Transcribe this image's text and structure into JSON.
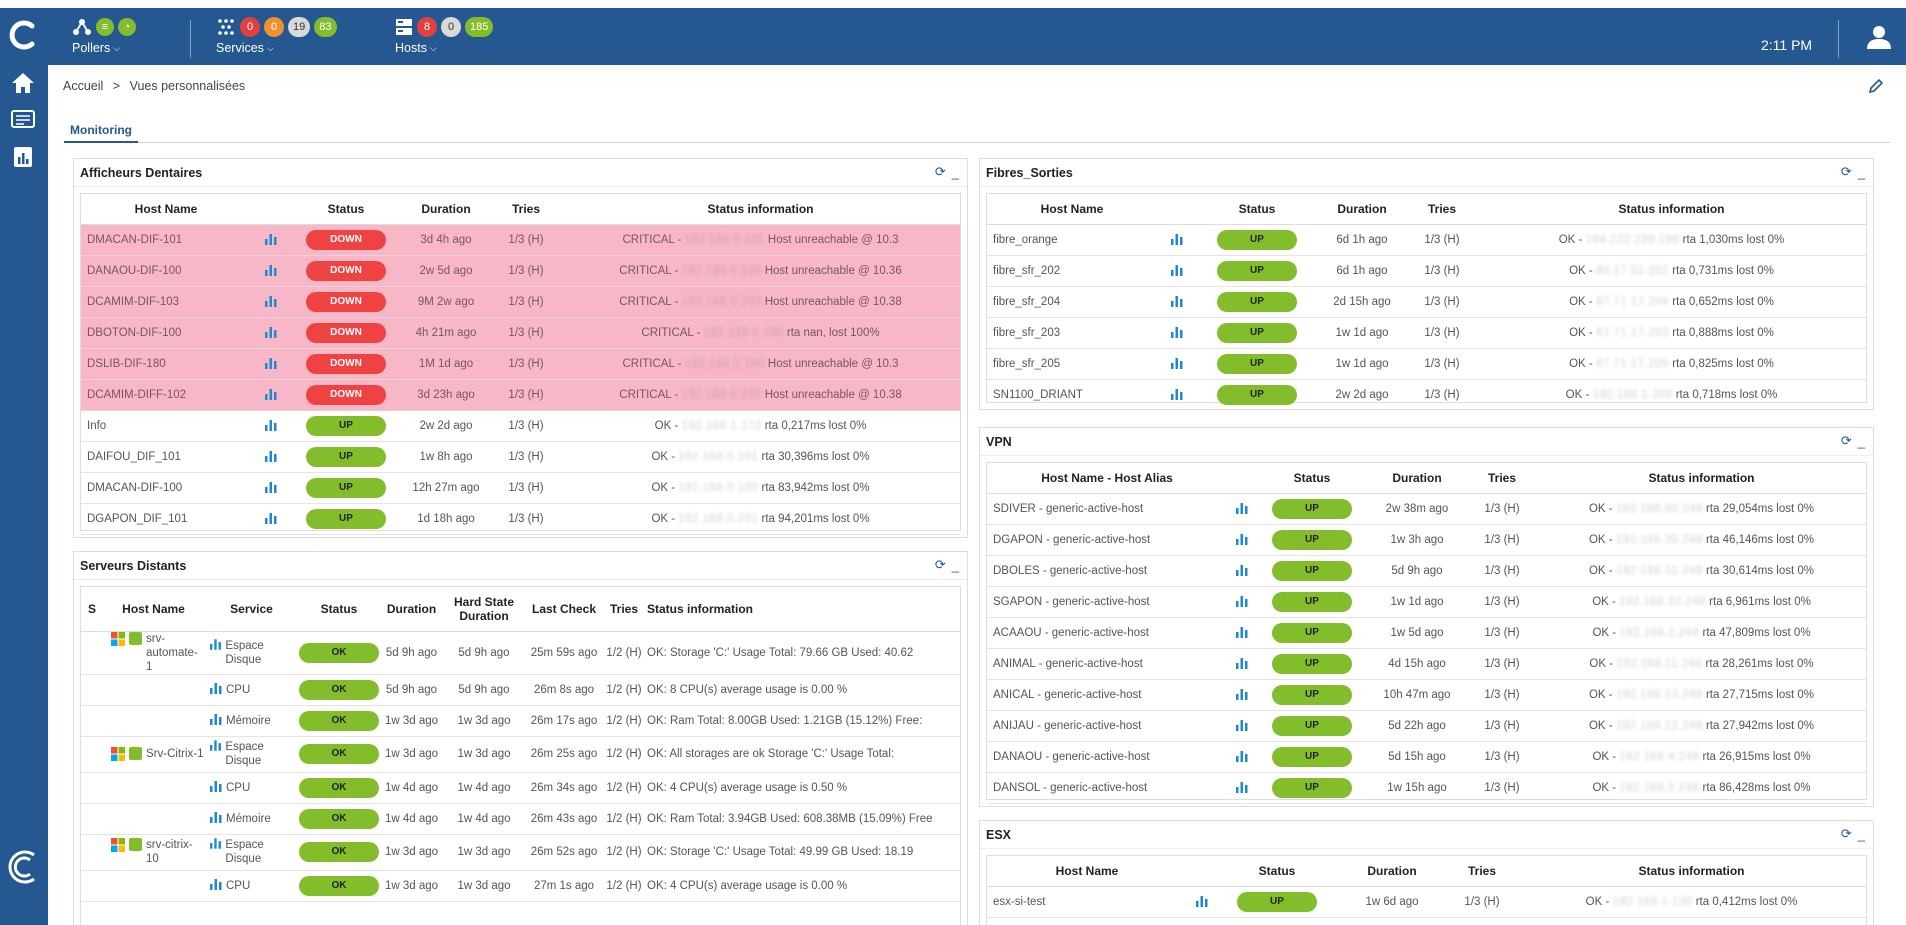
{
  "topbar": {
    "pollers_label": "Pollers",
    "services_label": "Services",
    "services_counts": [
      "0",
      "0",
      "19",
      "83"
    ],
    "hosts_label": "Hosts",
    "hosts_counts": [
      "8",
      "0",
      "185"
    ],
    "clock": "2:11 PM"
  },
  "breadcrumb": {
    "home": "Accueil",
    "sep": ">",
    "current": "Vues personnalisées"
  },
  "tabs": {
    "monitoring": "Monitoring"
  },
  "afficheurs": {
    "title": "Afficheurs Dentaires",
    "headers": [
      "Host Name",
      "Status",
      "Duration",
      "Tries",
      "Status information"
    ],
    "rows": [
      {
        "host": "DMACAN-DIF-101",
        "status": "DOWN",
        "duration": "3d 4h ago",
        "tries": "1/3 (H)",
        "info_a": "CRITICAL - ",
        "info_blur": "192.168.0.101",
        "info_b": " Host unreachable @ 10.3"
      },
      {
        "host": "DANAOU-DIF-100",
        "status": "DOWN",
        "duration": "2w 5d ago",
        "tries": "1/3 (H)",
        "info_a": "CRITICAL - ",
        "info_blur": "192.168.0.100",
        "info_b": " Host unreachable @ 10.36"
      },
      {
        "host": "DCAMIM-DIF-103",
        "status": "DOWN",
        "duration": "9M 2w ago",
        "tries": "1/3 (H)",
        "info_a": "CRITICAL - ",
        "info_blur": "192.168.0.103",
        "info_b": " Host unreachable @ 10.38"
      },
      {
        "host": "DBOTON-DIF-100",
        "status": "DOWN",
        "duration": "4h 21m ago",
        "tries": "1/3 (H)",
        "info_a": "CRITICAL - ",
        "info_blur": "192.168.0.100",
        "info_b": " rta nan, lost 100%"
      },
      {
        "host": "DSLIB-DIF-180",
        "status": "DOWN",
        "duration": "1M 1d ago",
        "tries": "1/3 (H)",
        "info_a": "CRITICAL - ",
        "info_blur": "192.168.0.180",
        "info_b": " Host unreachable @ 10.3"
      },
      {
        "host": "DCAMIM-DIFF-102",
        "status": "DOWN",
        "duration": "3d 23h ago",
        "tries": "1/3 (H)",
        "info_a": "CRITICAL - ",
        "info_blur": "192.168.0.102",
        "info_b": " Host unreachable @ 10.38"
      },
      {
        "host": "Info",
        "status": "UP",
        "duration": "2w 2d ago",
        "tries": "1/3 (H)",
        "info_a": "OK - ",
        "info_blur": "192.168.1.172",
        "info_b": " rta 0,217ms lost 0%"
      },
      {
        "host": "DAIFOU_DIF_101",
        "status": "UP",
        "duration": "1w 8h ago",
        "tries": "1/3 (H)",
        "info_a": "OK - ",
        "info_blur": "192.168.0.101",
        "info_b": " rta 30,396ms lost 0%"
      },
      {
        "host": "DMACAN-DIF-100",
        "status": "UP",
        "duration": "12h 27m ago",
        "tries": "1/3 (H)",
        "info_a": "OK - ",
        "info_blur": "192.168.0.100",
        "info_b": " rta 83,942ms lost 0%"
      },
      {
        "host": "DGAPON_DIF_101",
        "status": "UP",
        "duration": "1d 18h ago",
        "tries": "1/3 (H)",
        "info_a": "OK - ",
        "info_blur": "192.168.0.101",
        "info_b": " rta 94,201ms lost 0%"
      }
    ]
  },
  "serveurs": {
    "title": "Serveurs Distants",
    "headers": [
      "S",
      "Host Name",
      "Service",
      "Status",
      "Duration",
      "Hard State Duration",
      "Last Check",
      "Tries",
      "Status information"
    ],
    "rows": [
      {
        "host": "srv-automate-1",
        "service": "Espace Disque",
        "status": "OK",
        "duration": "5d 9h ago",
        "hard": "5d 9h ago",
        "last": "25m 59s ago",
        "tries": "1/2 (H)",
        "info": "OK: Storage 'C:' Usage Total: 79.66 GB Used: 40.62"
      },
      {
        "host": "",
        "service": "CPU",
        "status": "OK",
        "duration": "5d 9h ago",
        "hard": "5d 9h ago",
        "last": "26m 8s ago",
        "tries": "1/2 (H)",
        "info": "OK: 8 CPU(s) average usage is 0.00 %"
      },
      {
        "host": "",
        "service": "Mémoire",
        "status": "OK",
        "duration": "1w 3d ago",
        "hard": "1w 3d ago",
        "last": "26m 17s ago",
        "tries": "1/2 (H)",
        "info": "OK: Ram Total: 8.00GB Used: 1.21GB (15.12%) Free:"
      },
      {
        "host": "Srv-Citrix-1",
        "service": "Espace Disque",
        "status": "OK",
        "duration": "1w 3d ago",
        "hard": "1w 3d ago",
        "last": "26m 25s ago",
        "tries": "1/2 (H)",
        "info": "OK: All storages are ok Storage 'C:' Usage Total:"
      },
      {
        "host": "",
        "service": "CPU",
        "status": "OK",
        "duration": "1w 4d ago",
        "hard": "1w 4d ago",
        "last": "26m 34s ago",
        "tries": "1/2 (H)",
        "info": "OK: 4 CPU(s) average usage is 0.50 %"
      },
      {
        "host": "",
        "service": "Mémoire",
        "status": "OK",
        "duration": "1w 4d ago",
        "hard": "1w 4d ago",
        "last": "26m 43s ago",
        "tries": "1/2 (H)",
        "info": "OK: Ram Total: 3.94GB Used: 608.38MB (15.09%) Free"
      },
      {
        "host": "srv-citrix-10",
        "service": "Espace Disque",
        "status": "OK",
        "duration": "1w 3d ago",
        "hard": "1w 3d ago",
        "last": "26m 52s ago",
        "tries": "1/2 (H)",
        "info": "OK: Storage 'C:' Usage Total: 49.99 GB Used: 18.19"
      },
      {
        "host": "",
        "service": "CPU",
        "status": "OK",
        "duration": "1w 3d ago",
        "hard": "1w 3d ago",
        "last": "27m 1s ago",
        "tries": "1/2 (H)",
        "info": "OK: 4 CPU(s) average usage is 0.00 %"
      }
    ]
  },
  "fibres": {
    "title": "Fibres_Sorties",
    "headers": [
      "Host Name",
      "Status",
      "Duration",
      "Tries",
      "Status information"
    ],
    "rows": [
      {
        "host": "fibre_orange",
        "status": "UP",
        "duration": "6d 1h ago",
        "tries": "1/3 (H)",
        "info_a": "OK - ",
        "info_blur": "194.222.239.199",
        "info_b": " rta 1,030ms lost 0%"
      },
      {
        "host": "fibre_sfr_202",
        "status": "UP",
        "duration": "6d 1h ago",
        "tries": "1/3 (H)",
        "info_a": "OK - ",
        "info_blur": "80.17.51.202",
        "info_b": " rta 0,731ms lost 0%"
      },
      {
        "host": "fibre_sfr_204",
        "status": "UP",
        "duration": "2d 15h ago",
        "tries": "1/3 (H)",
        "info_a": "OK - ",
        "info_blur": "87.71.17.204",
        "info_b": " rta 0,652ms lost 0%"
      },
      {
        "host": "fibre_sfr_203",
        "status": "UP",
        "duration": "1w 1d ago",
        "tries": "1/3 (H)",
        "info_a": "OK - ",
        "info_blur": "87.71.17.203",
        "info_b": " rta 0,888ms lost 0%"
      },
      {
        "host": "fibre_sfr_205",
        "status": "UP",
        "duration": "1w 1d ago",
        "tries": "1/3 (H)",
        "info_a": "OK - ",
        "info_blur": "87.71.17.205",
        "info_b": " rta 0,825ms lost 0%"
      },
      {
        "host": "SN1100_DRIANT",
        "status": "UP",
        "duration": "2w 2d ago",
        "tries": "1/3 (H)",
        "info_a": "OK - ",
        "info_blur": "192.168.1.200",
        "info_b": " rta 0,718ms lost 0%"
      }
    ]
  },
  "vpn": {
    "title": "VPN",
    "headers": [
      "Host Name - Host Alias",
      "Status",
      "Duration",
      "Tries",
      "Status information"
    ],
    "rows": [
      {
        "host": "SDIVER - generic-active-host",
        "status": "UP",
        "duration": "2w 38m ago",
        "tries": "1/3 (H)",
        "info_a": "OK - ",
        "info_blur": "192.168.80.248",
        "info_b": " rta 29,054ms lost 0%"
      },
      {
        "host": "DGAPON - generic-active-host",
        "status": "UP",
        "duration": "1w 3h ago",
        "tries": "1/3 (H)",
        "info_a": "OK - ",
        "info_blur": "192.168.30.248",
        "info_b": " rta 46,146ms lost 0%"
      },
      {
        "host": "DBOLES - generic-active-host",
        "status": "UP",
        "duration": "5d 9h ago",
        "tries": "1/3 (H)",
        "info_a": "OK - ",
        "info_blur": "192.168.31.248",
        "info_b": " rta 30,614ms lost 0%"
      },
      {
        "host": "SGAPON - generic-active-host",
        "status": "UP",
        "duration": "1w 1d ago",
        "tries": "1/3 (H)",
        "info_a": "OK - ",
        "info_blur": "192.168.32.248",
        "info_b": " rta 6,961ms lost 0%"
      },
      {
        "host": "ACAAOU - generic-active-host",
        "status": "UP",
        "duration": "1w 5d ago",
        "tries": "1/3 (H)",
        "info_a": "OK - ",
        "info_blur": "192.168.2.248",
        "info_b": " rta 47,809ms lost 0%"
      },
      {
        "host": "ANIMAL - generic-active-host",
        "status": "UP",
        "duration": "4d 15h ago",
        "tries": "1/3 (H)",
        "info_a": "OK - ",
        "info_blur": "192.168.11.248",
        "info_b": " rta 28,261ms lost 0%"
      },
      {
        "host": "ANICAL - generic-active-host",
        "status": "UP",
        "duration": "10h 47m ago",
        "tries": "1/3 (H)",
        "info_a": "OK - ",
        "info_blur": "192.168.13.248",
        "info_b": " rta 27,715ms lost 0%"
      },
      {
        "host": "ANIJAU - generic-active-host",
        "status": "UP",
        "duration": "5d 22h ago",
        "tries": "1/3 (H)",
        "info_a": "OK - ",
        "info_blur": "192.168.12.248",
        "info_b": " rta 27,942ms lost 0%"
      },
      {
        "host": "DANAOU - generic-active-host",
        "status": "UP",
        "duration": "5d 15h ago",
        "tries": "1/3 (H)",
        "info_a": "OK - ",
        "info_blur": "192.168.4.248",
        "info_b": " rta 26,915ms lost 0%"
      },
      {
        "host": "DANSOL - generic-active-host",
        "status": "UP",
        "duration": "1w 15h ago",
        "tries": "1/3 (H)",
        "info_a": "OK - ",
        "info_blur": "192.168.5.248",
        "info_b": " rta 86,428ms lost 0%"
      }
    ]
  },
  "esx": {
    "title": "ESX",
    "headers": [
      "Host Name",
      "Status",
      "Duration",
      "Tries",
      "Status information"
    ],
    "rows": [
      {
        "host": "esx-si-test",
        "status": "UP",
        "duration": "1w 6d ago",
        "tries": "1/3 (H)",
        "info_a": "OK - ",
        "info_blur": "192.168.1.130",
        "info_b": " rta 0,412ms lost 0%"
      }
    ]
  },
  "colors": {
    "brand": "#255891",
    "up": "#84bd2b",
    "down": "#ef4343",
    "down_row": "#f7b7c7"
  }
}
